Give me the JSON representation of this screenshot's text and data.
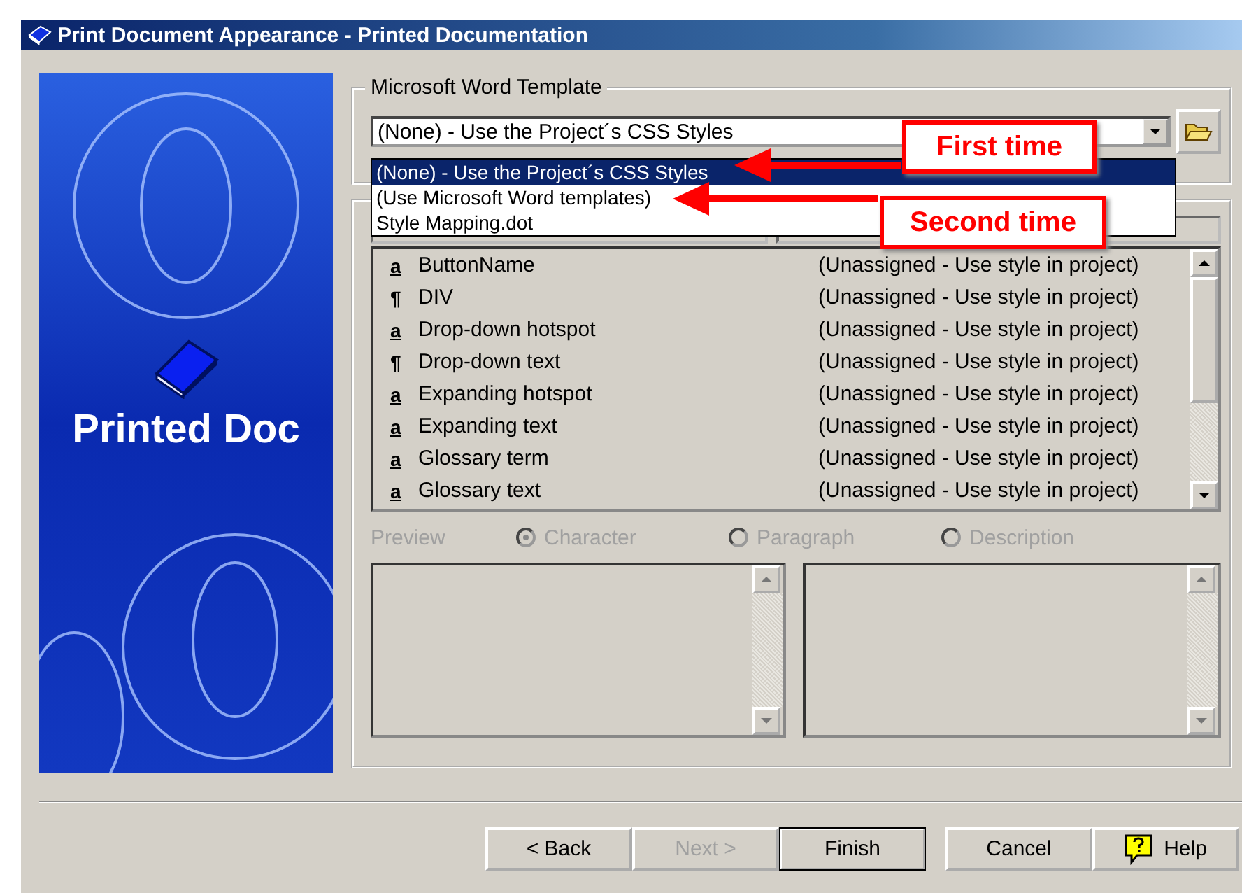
{
  "window": {
    "title": "Print Document Appearance - Printed Documentation"
  },
  "banner": {
    "title": "Printed Doc"
  },
  "template_group": {
    "label": "Microsoft Word Template",
    "value": "(None) - Use the Project´s CSS Styles",
    "expanded": true,
    "options": [
      {
        "label": "(None) - Use the Project´s CSS Styles",
        "selected": true
      },
      {
        "label": "(Use Microsoft Word templates)",
        "selected": false
      },
      {
        "label": "Style Mapping.dot",
        "selected": false
      }
    ]
  },
  "styles_list": {
    "rows": [
      {
        "kind": "character",
        "glyph": "a",
        "name": "ButtonName",
        "mapping": "(Unassigned - Use style in project)"
      },
      {
        "kind": "paragraph",
        "glyph": "¶",
        "name": "DIV",
        "mapping": "(Unassigned - Use style in project)"
      },
      {
        "kind": "character",
        "glyph": "a",
        "name": "Drop-down hotspot",
        "mapping": "(Unassigned - Use style in project)"
      },
      {
        "kind": "paragraph",
        "glyph": "¶",
        "name": "Drop-down text",
        "mapping": "(Unassigned - Use style in project)"
      },
      {
        "kind": "character",
        "glyph": "a",
        "name": "Expanding hotspot",
        "mapping": "(Unassigned - Use style in project)"
      },
      {
        "kind": "character",
        "glyph": "a",
        "name": "Expanding text",
        "mapping": "(Unassigned - Use style in project)"
      },
      {
        "kind": "character",
        "glyph": "a",
        "name": "Glossary term",
        "mapping": "(Unassigned - Use style in project)"
      },
      {
        "kind": "character",
        "glyph": "a",
        "name": "Glossary text",
        "mapping": "(Unassigned - Use style in project)"
      }
    ]
  },
  "preview": {
    "label": "Preview",
    "disabled": true,
    "options": [
      {
        "label": "Character",
        "selected": true
      },
      {
        "label": "Paragraph",
        "selected": false
      },
      {
        "label": "Description",
        "selected": false
      }
    ]
  },
  "buttons": [
    {
      "kind": "plain",
      "label": "< Back",
      "disabled": false,
      "default": false
    },
    {
      "kind": "plain",
      "label": "Next >",
      "disabled": true,
      "default": false
    },
    {
      "kind": "plain",
      "label": "Finish",
      "disabled": false,
      "default": true
    },
    {
      "kind": "plain",
      "label": "Cancel",
      "disabled": false,
      "default": false
    },
    {
      "kind": "help",
      "label": "Help",
      "disabled": false,
      "default": false
    }
  ],
  "annotations": [
    {
      "text": "First time"
    },
    {
      "text": "Second time"
    }
  ]
}
